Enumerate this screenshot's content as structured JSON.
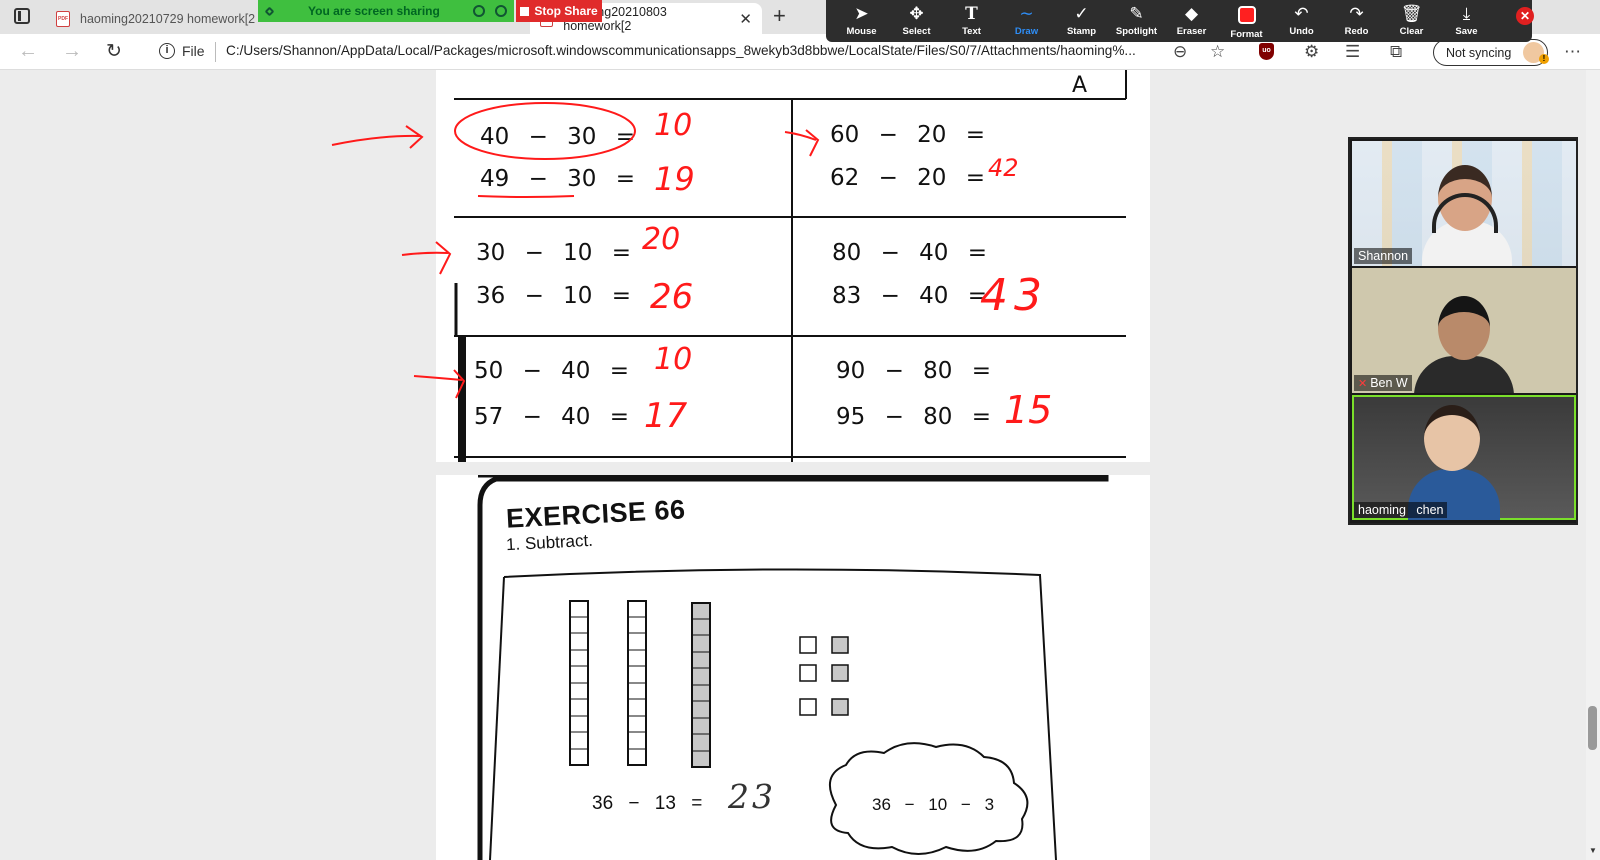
{
  "browser": {
    "tabs": [
      {
        "title": "haoming20210729 homework[2"
      },
      {
        "title": "haoming20210803 homework[2"
      }
    ],
    "share_banner": "You are screen sharing",
    "stop_share": "Stop Share",
    "file_label": "File",
    "url": "C:/Users/Shannon/AppData/Local/Packages/microsoft.windowscommunicationsapps_8wekyb3d8bbwe/LocalState/Files/S0/7/Attachments/haoming%...",
    "not_syncing": "Not syncing"
  },
  "annotate_toolbar": {
    "tools": [
      {
        "label": "Mouse",
        "icon": "pointer-icon"
      },
      {
        "label": "Select",
        "icon": "move-icon"
      },
      {
        "label": "Text",
        "icon": "text-icon"
      },
      {
        "label": "Draw",
        "icon": "draw-icon"
      },
      {
        "label": "Stamp",
        "icon": "checkmark-icon"
      },
      {
        "label": "Spotlight",
        "icon": "spotlight-icon"
      },
      {
        "label": "Eraser",
        "icon": "eraser-icon"
      },
      {
        "label": "Format",
        "icon": "color-swatch-icon"
      },
      {
        "label": "Undo",
        "icon": "undo-icon"
      },
      {
        "label": "Redo",
        "icon": "redo-icon"
      },
      {
        "label": "Clear",
        "icon": "trash-icon"
      },
      {
        "label": "Save",
        "icon": "download-icon"
      }
    ],
    "format_color": "#ff2020",
    "draw_color": "#2e8ef7"
  },
  "worksheet": {
    "problems": [
      {
        "eq": "40 − 30 =",
        "answer": "10"
      },
      {
        "eq": "49 − 30 =",
        "answer": "19"
      },
      {
        "eq": "60 − 20 =",
        "answer": ""
      },
      {
        "eq": "62 − 20 =",
        "answer": "42"
      },
      {
        "eq": "30 − 10 =",
        "answer": "20"
      },
      {
        "eq": "36 − 10 =",
        "answer": "26"
      },
      {
        "eq": "80 − 40 =",
        "answer": ""
      },
      {
        "eq": "83 − 40 =",
        "answer": "43"
      },
      {
        "eq": "50 − 40 =",
        "answer": "10"
      },
      {
        "eq": "57 − 40 =",
        "answer": "17"
      },
      {
        "eq": "90 − 80 =",
        "answer": ""
      },
      {
        "eq": "95 − 80 =",
        "answer": "15"
      }
    ],
    "ink_color": "#ff1a1a"
  },
  "exercise": {
    "title": "EXERCISE 66",
    "instruction": "1.  Subtract.",
    "equation": "36 − 13 =",
    "answer": "23",
    "cloud": "36 − 10 − 3"
  },
  "participants": [
    {
      "name": "Shannon",
      "muted": false
    },
    {
      "name": "Ben W",
      "muted": true
    },
    {
      "name": "haoming   chen",
      "muted": false
    }
  ],
  "speaking_color": "#7adf2a"
}
